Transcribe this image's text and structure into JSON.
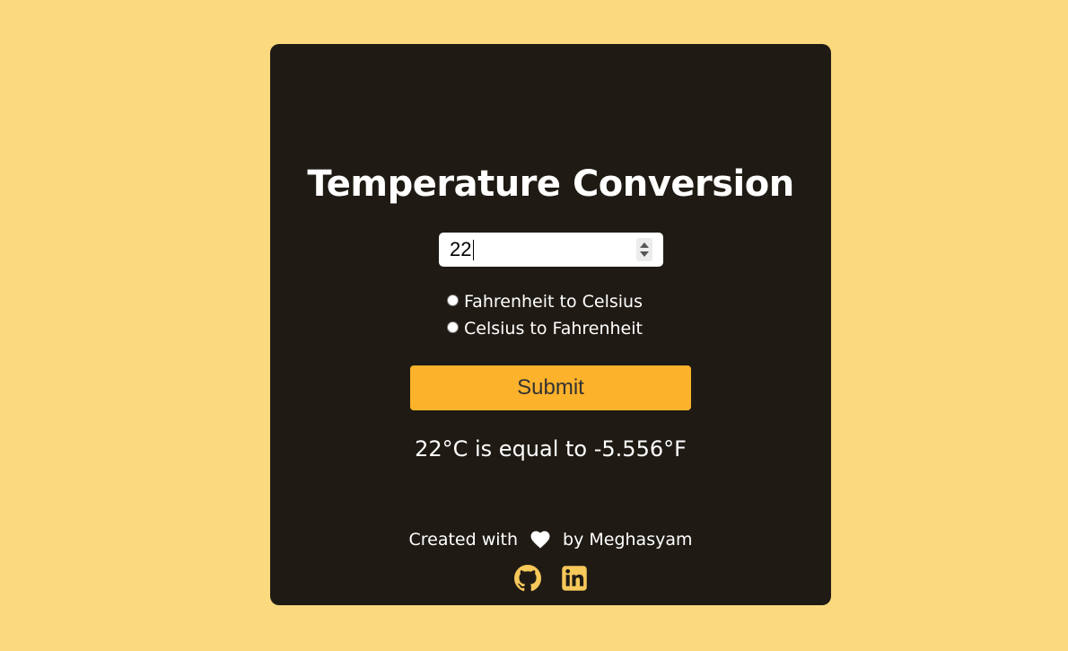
{
  "title": "Temperature Conversion",
  "input": {
    "value": "22"
  },
  "options": [
    {
      "label": "Fahrenheit to Celsius",
      "selected": false
    },
    {
      "label": "Celsius to Fahrenheit",
      "selected": false
    }
  ],
  "submit_label": "Submit",
  "result": "22°C is equal to -5.556°F",
  "footer": {
    "created_with": "Created with",
    "by": "by Meghasyam"
  },
  "icons": {
    "heart": "heart-icon",
    "github": "github-icon",
    "linkedin": "linkedin-icon"
  },
  "colors": {
    "background": "#fad97f",
    "card": "#1f1b14",
    "accent": "#fdb22c",
    "icon_gold": "#f7c85a"
  }
}
